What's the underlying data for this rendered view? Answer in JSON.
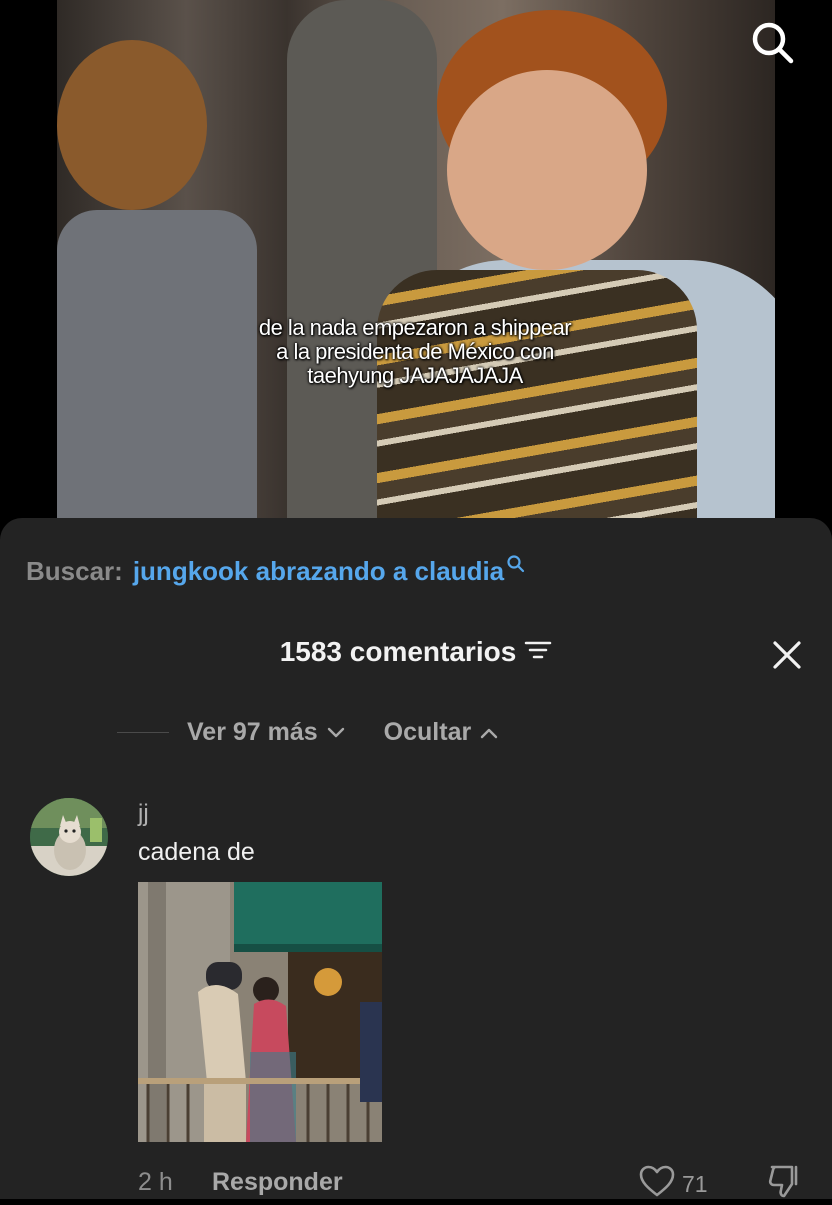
{
  "video": {
    "caption_lines": [
      "de la nada empezaron a shippear",
      "a la presidenta de México con",
      "taehyung JAJAJAJAJA"
    ],
    "search_icon": "search-icon"
  },
  "search_suggestion": {
    "prefix": "Buscar:",
    "query": "jungkook abrazando a claudia",
    "icon": "search-icon"
  },
  "comments_header": {
    "count_label": "1583 comentarios",
    "filter_icon": "filter-icon",
    "close_icon": "close-icon"
  },
  "replies_controls": {
    "more_label": "Ver 97 más",
    "more_icon": "chevron-down-icon",
    "hide_label": "Ocultar",
    "hide_icon": "chevron-up-icon"
  },
  "comment": {
    "username": "jj",
    "text": "cadena de",
    "timestamp": "2 h",
    "reply_label": "Responder",
    "likes": "71",
    "like_icon": "heart-icon",
    "dislike_icon": "thumbs-down-icon"
  },
  "colors": {
    "sheet_background": "#232323",
    "link_blue": "#56a7ec",
    "primary_text": "#f2f2f2",
    "secondary_text": "#a9a9a9"
  }
}
